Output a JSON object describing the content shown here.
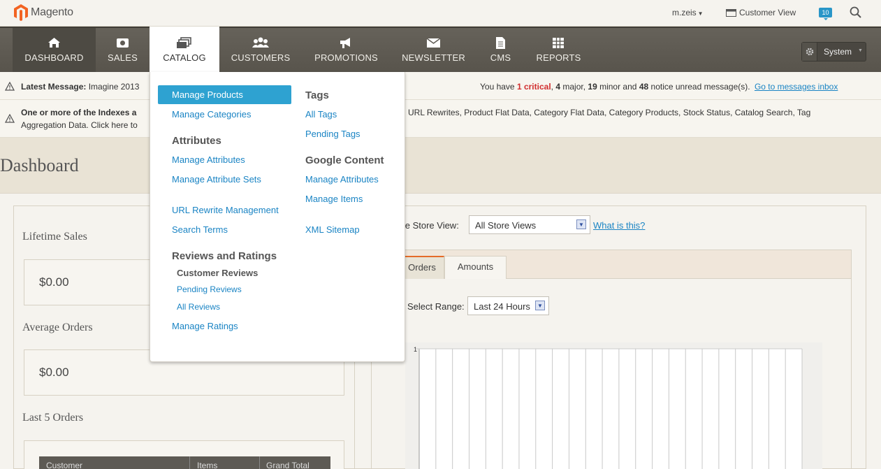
{
  "header": {
    "logo_text": "Magento",
    "user_label": "m.zeis",
    "customer_view_label": "Customer View",
    "notifications_count": "10"
  },
  "nav": {
    "items": [
      {
        "label": "DASHBOARD",
        "icon": "home-icon"
      },
      {
        "label": "SALES",
        "icon": "sales-icon"
      },
      {
        "label": "CATALOG",
        "icon": "catalog-icon"
      },
      {
        "label": "CUSTOMERS",
        "icon": "customers-icon"
      },
      {
        "label": "PROMOTIONS",
        "icon": "megaphone-icon"
      },
      {
        "label": "NEWSLETTER",
        "icon": "envelope-icon"
      },
      {
        "label": "CMS",
        "icon": "document-icon"
      },
      {
        "label": "REPORTS",
        "icon": "grid-icon"
      }
    ],
    "system_label": "System"
  },
  "messages": {
    "latest_prefix": "Latest Message:",
    "latest_text": "Imagine 2013",
    "counts_pre": "You have",
    "critical_count": "1 critical",
    "major": "4",
    "major_label": "major,",
    "minor": "19",
    "minor_label": "minor and",
    "notice": "48",
    "notice_label": "notice unread message(s).",
    "inbox_link": "Go to messages inbox",
    "index_line1_bold": "One or more of the Indexes a",
    "index_line1_rest": "URL Rewrites, Product Flat Data, Category Flat Data, Category Products, Stock Status, Catalog Search, Tag",
    "index_line2": "Aggregation Data. Click here to"
  },
  "page": {
    "title": "Dashboard"
  },
  "stats": {
    "lifetime_label": "Lifetime Sales",
    "lifetime_value": "$0.00",
    "average_label": "Average Orders",
    "average_value": "$0.00",
    "last_orders_label": "Last 5 Orders",
    "columns": [
      "Customer",
      "Items",
      "Grand Total"
    ]
  },
  "chart_panel": {
    "store_label": "ose Store View:",
    "store_value": "All Store Views",
    "whatis_link": "What is this?",
    "tabs": [
      "Orders",
      "Amounts"
    ],
    "range_label": "Select Range:",
    "range_value": "Last 24 Hours",
    "y_tick": "1"
  },
  "catalog_menu": {
    "manage_products": "Manage Products",
    "manage_categories": "Manage Categories",
    "attributes_head": "Attributes",
    "manage_attributes": "Manage Attributes",
    "manage_attribute_sets": "Manage Attribute Sets",
    "url_rewrite": "URL Rewrite Management",
    "search_terms": "Search Terms",
    "reviews_head": "Reviews and Ratings",
    "customer_reviews": "Customer Reviews",
    "pending_reviews": "Pending Reviews",
    "all_reviews": "All Reviews",
    "manage_ratings": "Manage Ratings",
    "tags_head": "Tags",
    "all_tags": "All Tags",
    "pending_tags": "Pending Tags",
    "google_head": "Google Content",
    "google_manage_attributes": "Manage Attributes",
    "google_manage_items": "Manage Items",
    "xml_sitemap": "XML Sitemap"
  }
}
